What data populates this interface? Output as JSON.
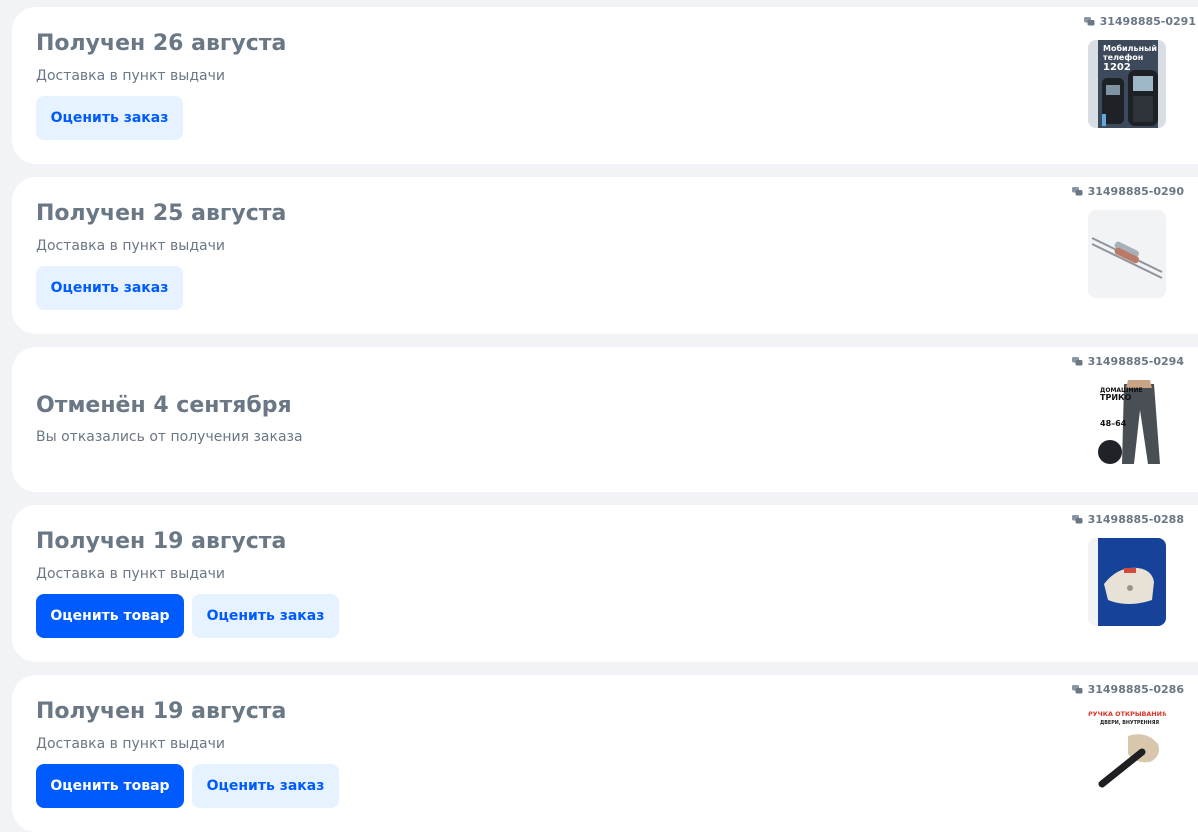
{
  "orders": [
    {
      "status": "Получен 26 августа",
      "details": "Доставка в пункт выдачи",
      "order_number": "31498885-0291",
      "rate_order_label": "Оценить заказ",
      "thumbnail": {
        "icon": "mobile-phone-icon",
        "text": [
          "Мобильный",
          "телефон",
          "1202"
        ]
      }
    },
    {
      "status": "Получен 25 августа",
      "details": "Доставка в пункт выдачи",
      "order_number": "31498885-0290",
      "rate_order_label": "Оценить заказ",
      "thumbnail": {
        "icon": "thermal-fuse-icon"
      }
    },
    {
      "status": "Отменён 4 сентября",
      "details": "Вы отказались от получения заказа",
      "order_number": "31498885-0294",
      "thumbnail": {
        "icon": "sweatpants-icon",
        "text": [
          "ДОМАШНИЕ",
          "ТРИКО",
          "48–64"
        ]
      }
    },
    {
      "status": "Получен 19 августа",
      "details": "Доставка в пункт выдачи",
      "order_number": "31498885-0288",
      "rate_product_label": "Оценить товар",
      "rate_order_label": "Оценить заказ",
      "thumbnail": {
        "icon": "foam-cushion-icon"
      }
    },
    {
      "status": "Получен 19 августа",
      "details": "Доставка в пункт выдачи",
      "order_number": "31498885-0286",
      "rate_product_label": "Оценить товар",
      "rate_order_label": "Оценить заказ",
      "thumbnail": {
        "icon": "door-handle-icon",
        "text": [
          "РУЧКА ОТКРЫВАНИЯ",
          "ДВЕРИ, ВНУТРЕННЯЯ"
        ]
      }
    }
  ],
  "colors": {
    "primary": "#005bff",
    "light_button": "#e6f2ff",
    "muted_text": "#6a7785",
    "background": "#f1f3f7"
  }
}
